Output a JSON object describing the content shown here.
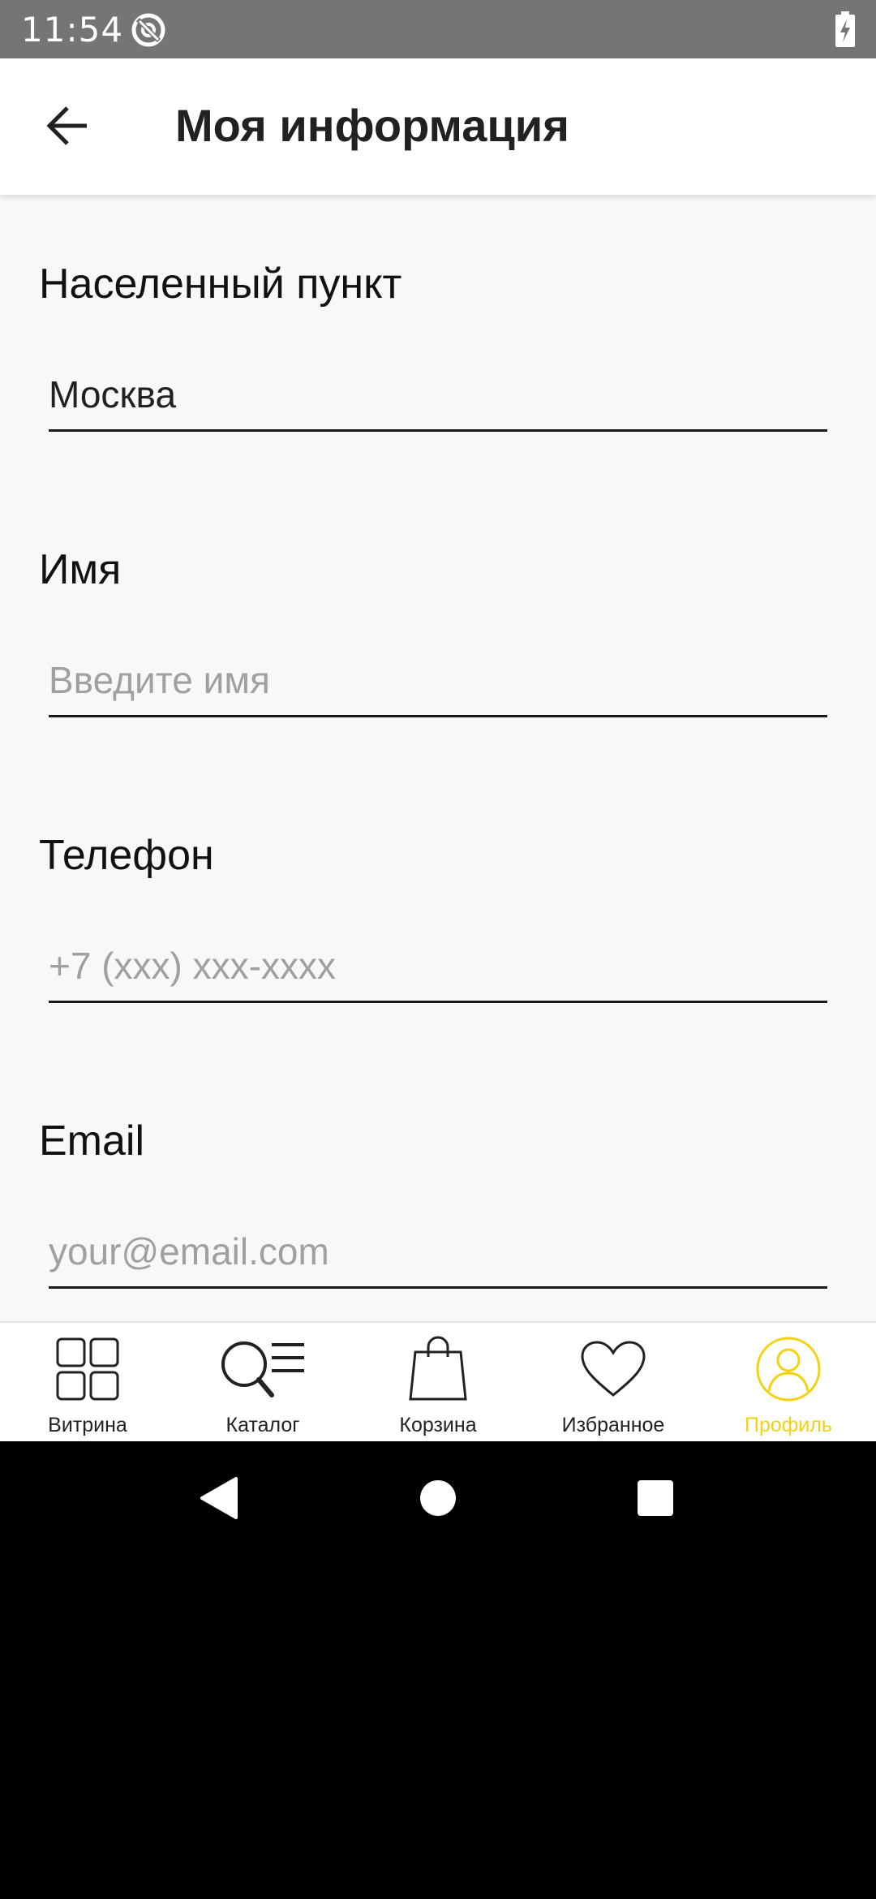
{
  "status_bar": {
    "time": "11:54",
    "app_icon": "at-sign-icon",
    "battery_icon": "battery-charging-icon"
  },
  "app_bar": {
    "back_icon": "arrow-left-icon",
    "title": "Моя информация"
  },
  "form": {
    "city": {
      "label": "Населенный пункт",
      "value": "Москва"
    },
    "name": {
      "label": "Имя",
      "value": "",
      "placeholder": "Введите имя"
    },
    "phone": {
      "label": "Телефон",
      "value": "",
      "placeholder": "+7 (xxx) xxx-xxxx"
    },
    "email": {
      "label": "Email",
      "value": "",
      "placeholder": "your@email.com"
    }
  },
  "bottom_nav": {
    "items": [
      {
        "label": "Витрина",
        "icon": "grid-icon",
        "active": false
      },
      {
        "label": "Каталог",
        "icon": "search-list-icon",
        "active": false
      },
      {
        "label": "Корзина",
        "icon": "shopping-bag-icon",
        "active": false
      },
      {
        "label": "Избранное",
        "icon": "heart-icon",
        "active": false
      },
      {
        "label": "Профиль",
        "icon": "profile-icon",
        "active": true
      }
    ],
    "active_color": "#f5d20f",
    "inactive_color": "#222222"
  },
  "system_nav": {
    "back": "triangle-back-icon",
    "home": "circle-home-icon",
    "recents": "square-recents-icon"
  }
}
